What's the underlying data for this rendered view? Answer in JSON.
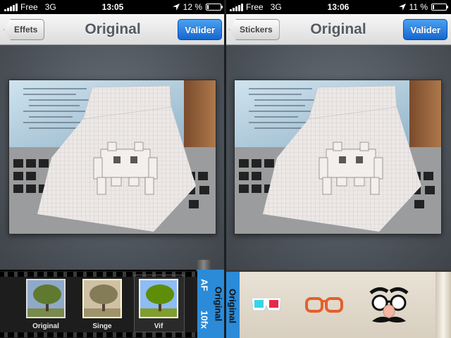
{
  "left": {
    "status": {
      "carrier": "Free",
      "network": "3G",
      "time": "13:05",
      "battery_text": "12 %",
      "battery_level": 0.12
    },
    "nav": {
      "back_label": "Effets",
      "title": "Original",
      "confirm_label": "Valider"
    },
    "filters": [
      {
        "label": "Original",
        "selected": false
      },
      {
        "label": "Singe",
        "selected": false
      },
      {
        "label": "Vif",
        "selected": true
      }
    ],
    "tabs": {
      "af": "AF",
      "fx": "10fx",
      "original": "Original"
    }
  },
  "right": {
    "status": {
      "carrier": "Free",
      "network": "3G",
      "time": "13:06",
      "battery_text": "11 %",
      "battery_level": 0.11
    },
    "nav": {
      "back_label": "Stickers",
      "title": "Original",
      "confirm_label": "Valider"
    },
    "tab_label": "Original",
    "stickers": [
      "3d-glasses-icon",
      "orange-glasses-icon",
      "groucho-disguise-icon"
    ]
  },
  "colors": {
    "accent_blue": "#2b8bd8",
    "valider_blue": "#1a6fd8",
    "nav_title": "#555b63"
  }
}
